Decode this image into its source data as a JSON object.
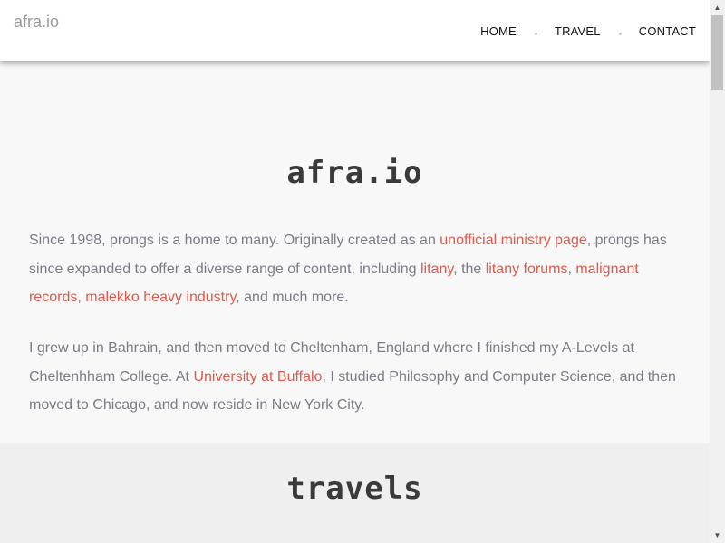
{
  "header": {
    "brand": "afra.io",
    "nav": [
      {
        "label": "HOME"
      },
      {
        "label": "TRAVEL"
      },
      {
        "label": "CONTACT"
      }
    ]
  },
  "about": {
    "title": "afra.io",
    "p1": {
      "t1": "Since 1998, prongs is a home to many. Originally created as an ",
      "l1": "unofficial ministry page",
      "t2": ", prongs has since expanded to offer a diverse range of content, including ",
      "l2": "litany",
      "t3": ", the ",
      "l3": "litany forums",
      "t4": ", ",
      "l4": "malignant records",
      "t5": ", ",
      "l5": "malekko heavy industry",
      "t6": ", and much more."
    },
    "p2": {
      "t1": "I grew up in Bahrain, and then moved to Cheltenham, England where I finished my A-Levels at Cheltenhham College. At ",
      "l1": "University at Buffalo",
      "t2": ", I studied Philosophy and Computer Science, and then moved to Chicago, and now reside in New York City."
    }
  },
  "travels": {
    "title": "travels"
  },
  "scrollbar": {
    "up_icon": "▲",
    "down_icon": "▼"
  },
  "colors": {
    "link": "#e0594c",
    "body_text": "#7c7c88",
    "heading": "#3a3a3a",
    "brand": "#9a9a9a"
  }
}
